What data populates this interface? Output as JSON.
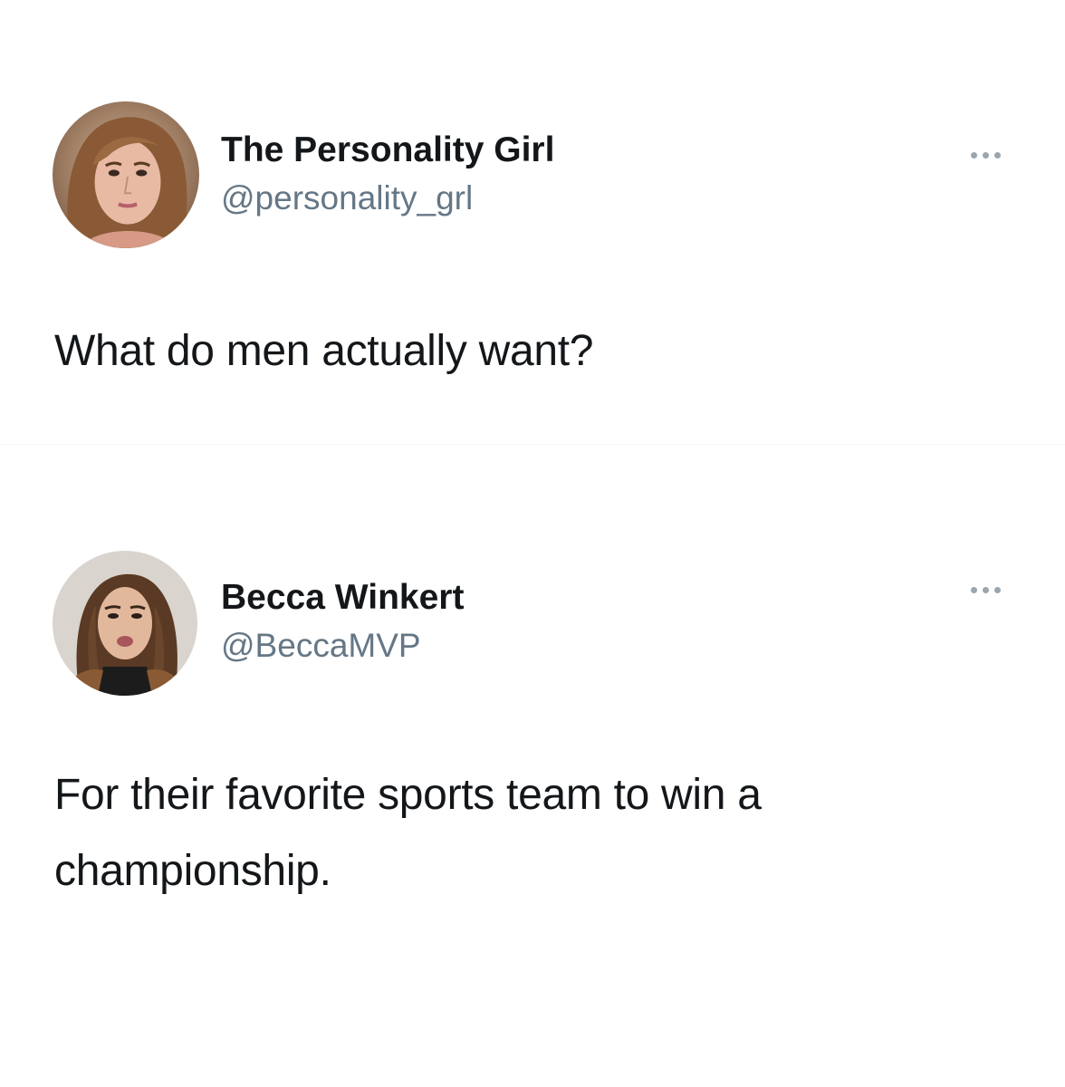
{
  "tweets": [
    {
      "display_name": "The Personality Girl",
      "handle": "@personality_grl",
      "text": "What do men actually want?",
      "avatar_icon": "profile-photo-icon",
      "more_icon": "more-options-icon"
    },
    {
      "display_name": "Becca Winkert",
      "handle": "@BeccaMVP",
      "text": "For their favorite sports team to win a championship.",
      "avatar_icon": "profile-photo-icon",
      "more_icon": "more-options-icon"
    }
  ],
  "colors": {
    "background": "#ffffff",
    "name_text": "#14171a",
    "handle_text": "#657786",
    "dots": "#9aa5ae"
  }
}
